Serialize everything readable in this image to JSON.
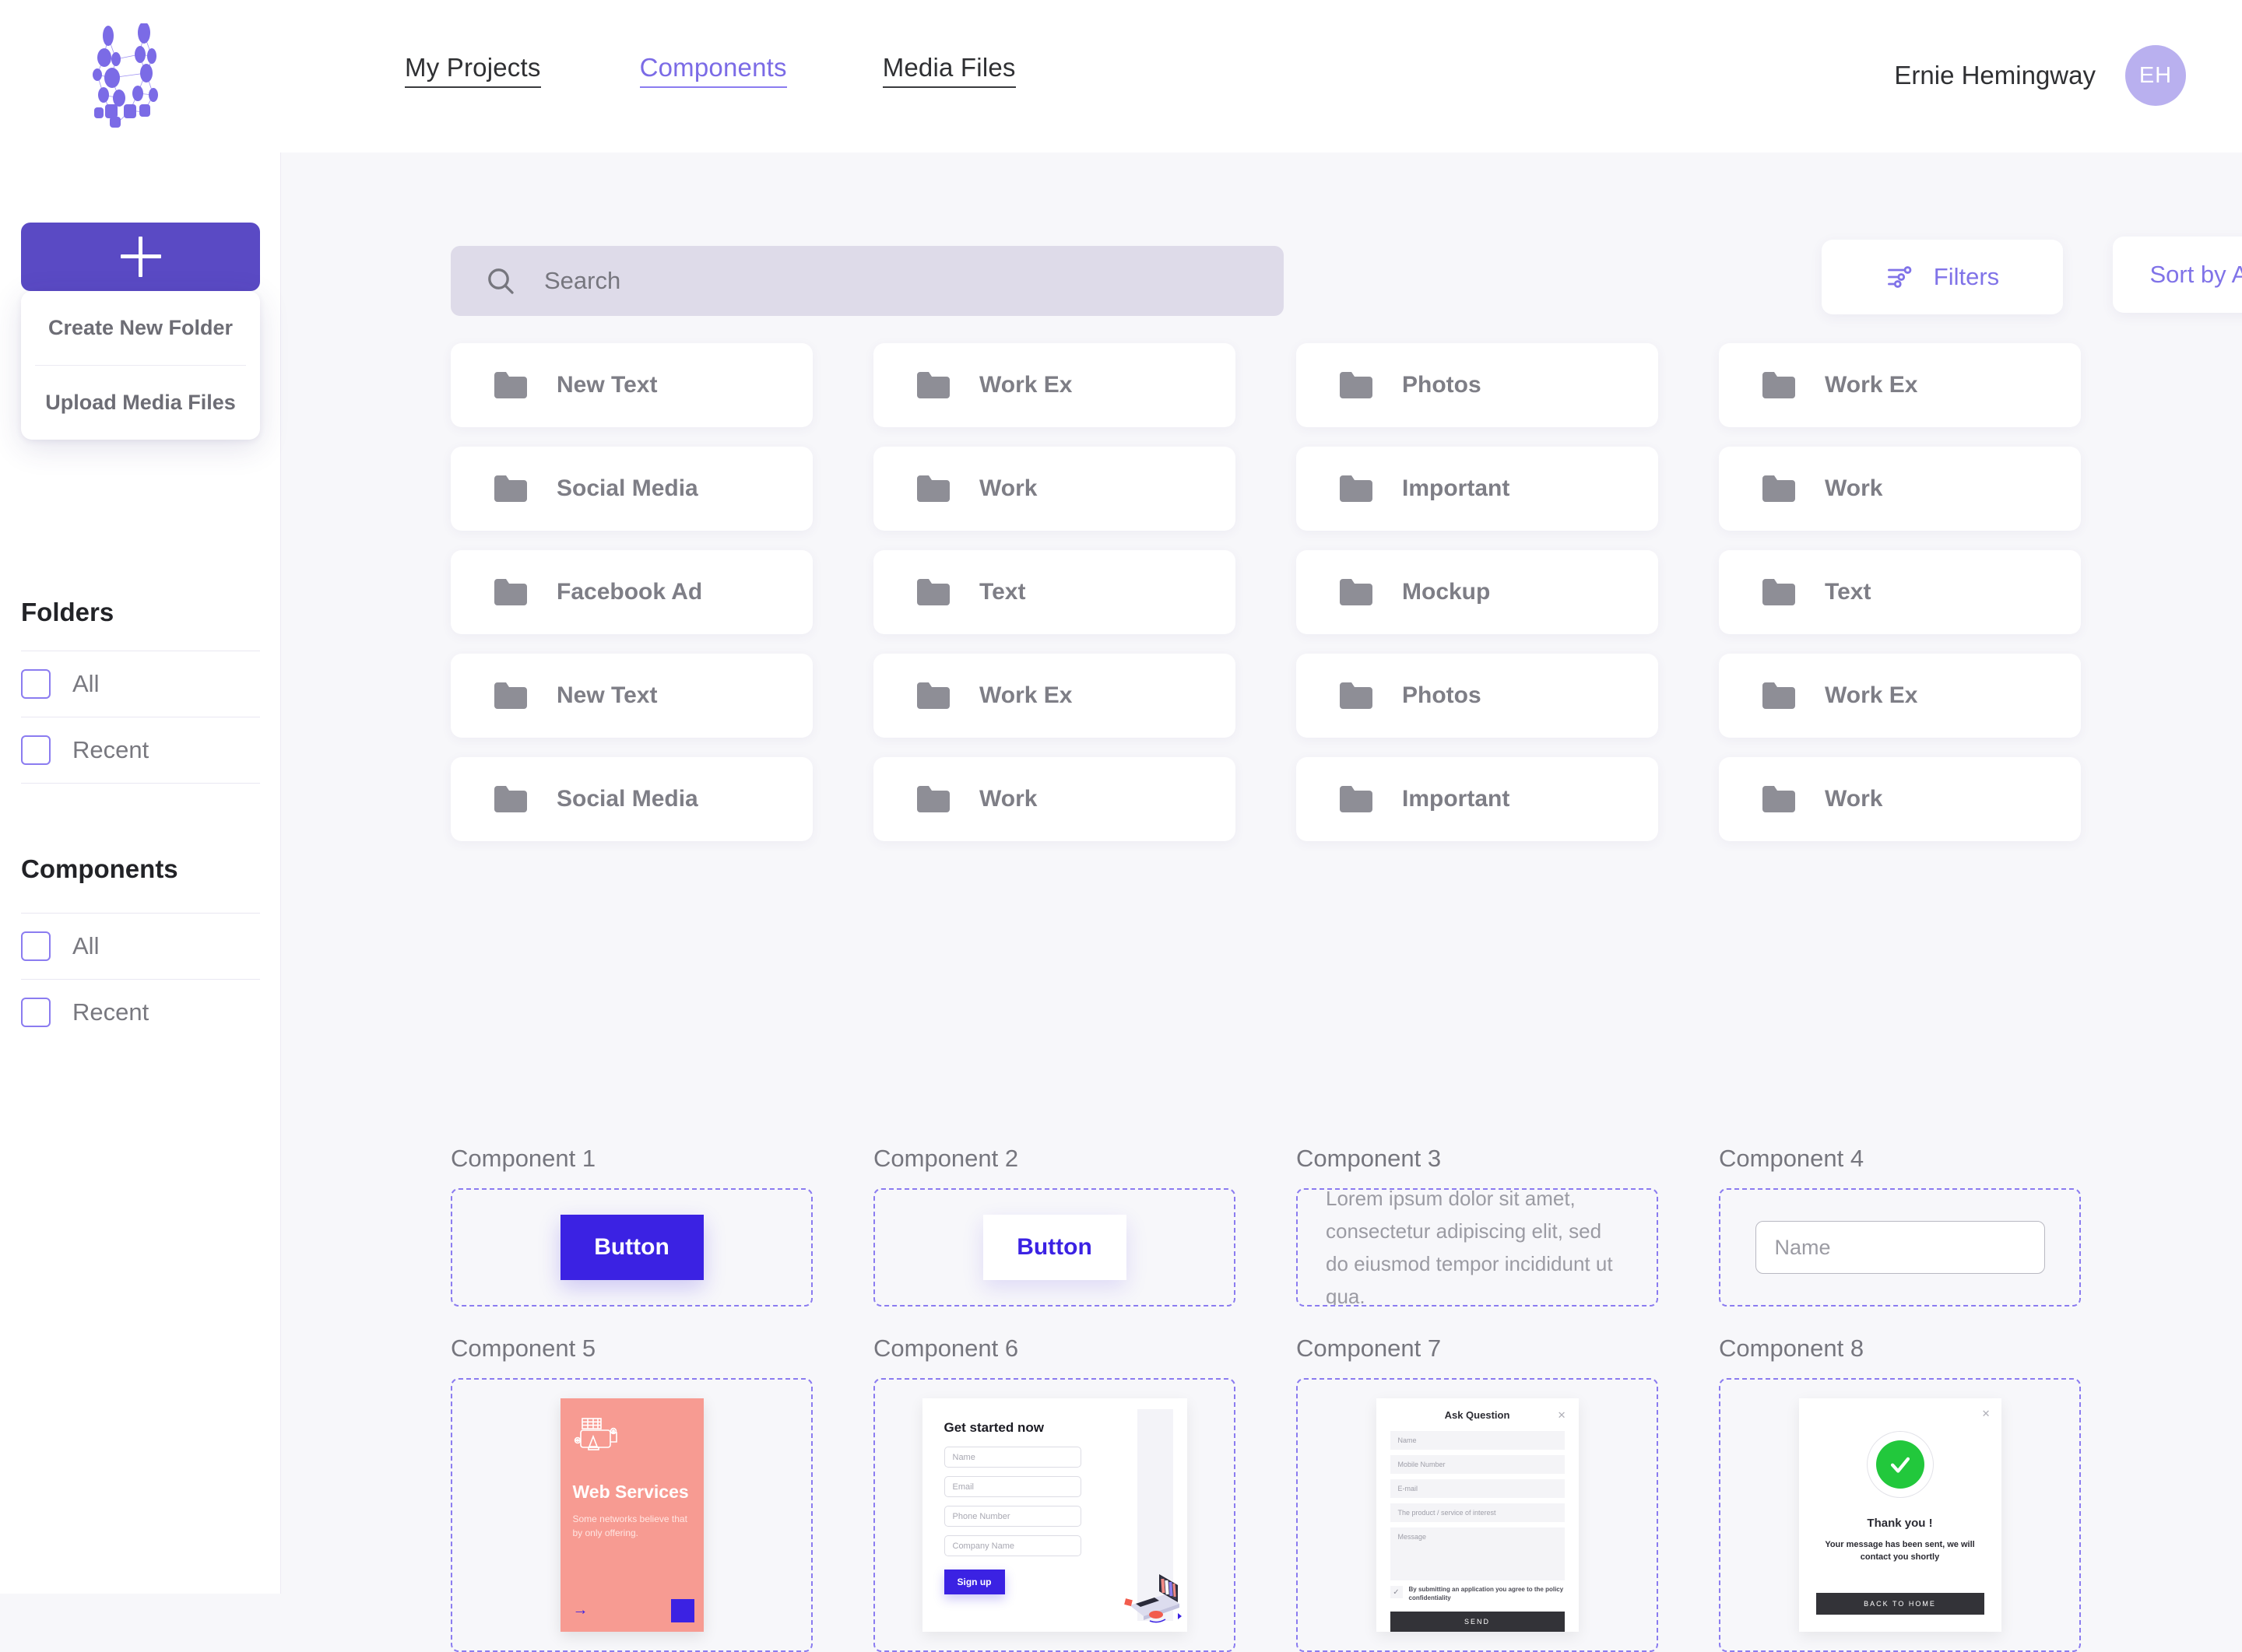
{
  "header": {
    "logo_name": "network-graph-logo",
    "nav": [
      {
        "label": "My Projects",
        "active": false
      },
      {
        "label": "Components",
        "active": true
      },
      {
        "label": "Media Files",
        "active": false
      }
    ],
    "user_name": "Ernie Hemingway",
    "avatar_initials": "EH"
  },
  "sidebar": {
    "add_button_icon": "plus-icon",
    "dropdown": {
      "items": [
        {
          "label": "Create New Folder"
        },
        {
          "label": "Upload Media Files"
        }
      ]
    },
    "sections": [
      {
        "heading": "Folders",
        "options": [
          {
            "label": "All",
            "checked": false
          },
          {
            "label": "Recent",
            "checked": false
          }
        ]
      },
      {
        "heading": "Components",
        "options": [
          {
            "label": "All",
            "checked": false
          },
          {
            "label": "Recent",
            "checked": false
          }
        ]
      }
    ]
  },
  "toolbar": {
    "search": {
      "placeholder": "Search",
      "value": "",
      "icon": "search-icon"
    },
    "filters_label": "Filters",
    "filters_icon": "sliders-icon",
    "sort_label": "Sort by A-Z",
    "sort_icon": "chevron-down-icon"
  },
  "folders": [
    {
      "name": "New Text"
    },
    {
      "name": "Work Ex"
    },
    {
      "name": "Photos"
    },
    {
      "name": "Work Ex"
    },
    {
      "name": "Social Media"
    },
    {
      "name": "Work"
    },
    {
      "name": "Important"
    },
    {
      "name": "Work"
    },
    {
      "name": "Facebook Ad"
    },
    {
      "name": "Text"
    },
    {
      "name": "Mockup"
    },
    {
      "name": "Text"
    },
    {
      "name": "New Text"
    },
    {
      "name": "Work Ex"
    },
    {
      "name": "Photos"
    },
    {
      "name": "Work Ex"
    },
    {
      "name": "Social Media"
    },
    {
      "name": "Work"
    },
    {
      "name": "Important"
    },
    {
      "name": "Work"
    }
  ],
  "components": {
    "c1": {
      "title": "Component 1",
      "button_label": "Button"
    },
    "c2": {
      "title": "Component 2",
      "button_label": "Button"
    },
    "c3": {
      "title": "Component 3",
      "text": "Lorem ipsum dolor sit amet, consectetur adipiscing elit, sed do eiusmod tempor incididunt ut qua."
    },
    "c4": {
      "title": "Component 4",
      "input_placeholder": "Name",
      "input_value": ""
    },
    "c5": {
      "title": "Component 5",
      "card_title": "Web Services",
      "card_desc": "Some networks believe that by only offering.",
      "arrow_icon": "arrow-right-icon",
      "illustration": "web-server-icon"
    },
    "c6": {
      "title": "Component 6",
      "card_title": "Get started now",
      "fields": [
        "Name",
        "Email",
        "Phone Number",
        "Company Name"
      ],
      "button_label": "Sign up",
      "illustration": "laptop-books-illustration"
    },
    "c7": {
      "title": "Component 7",
      "card_title": "Ask Question",
      "close_icon": "close-icon",
      "fields": [
        "Name",
        "Mobile Number",
        "E-mail",
        "The product / service of interest"
      ],
      "message_field": "Message",
      "consent_text": "By submitting an application you agree to the policy confidentiality",
      "consent_checked": true,
      "button_label": "SEND"
    },
    "c8": {
      "title": "Component 8",
      "close_icon": "close-icon",
      "status_icon": "check-circle-icon",
      "card_title": "Thank you !",
      "card_msg": "Your message has been sent, we will contact you shortly",
      "button_label": "BACK TO HOME"
    }
  },
  "colors": {
    "brand_purple": "#5a4ac4",
    "accent_violet": "#8b7cf0",
    "button_blue": "#3b22e3",
    "card_salmon": "#f79b92",
    "success_green": "#22c83c",
    "dark_button": "#333338"
  }
}
